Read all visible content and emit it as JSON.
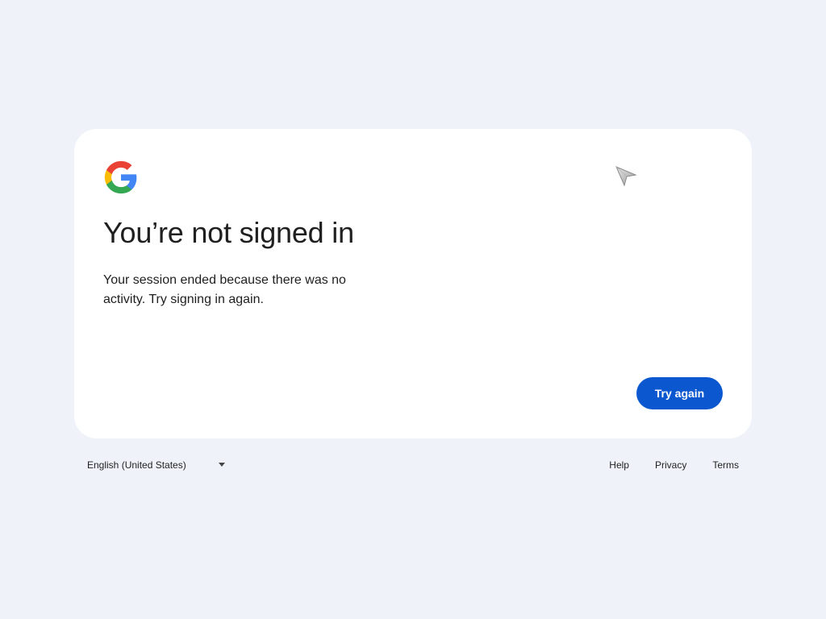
{
  "card": {
    "logo_icon": "google-g-logo",
    "title": "You’re not signed in",
    "message": "Your session ended because there was no activity. Try signing in again.",
    "cursor_icon": "mouse-pointer-icon",
    "try_again_label": "Try again"
  },
  "footer": {
    "language": "English (United States)",
    "links": [
      "Help",
      "Privacy",
      "Terms"
    ]
  },
  "colors": {
    "background": "#eff3f9",
    "card": "#ffffff",
    "accent": "#0b57d0",
    "text": "#1f1f1f",
    "google_blue": "#4285f4",
    "google_red": "#ea4335",
    "google_yellow": "#fbbc05",
    "google_green": "#34a853"
  }
}
